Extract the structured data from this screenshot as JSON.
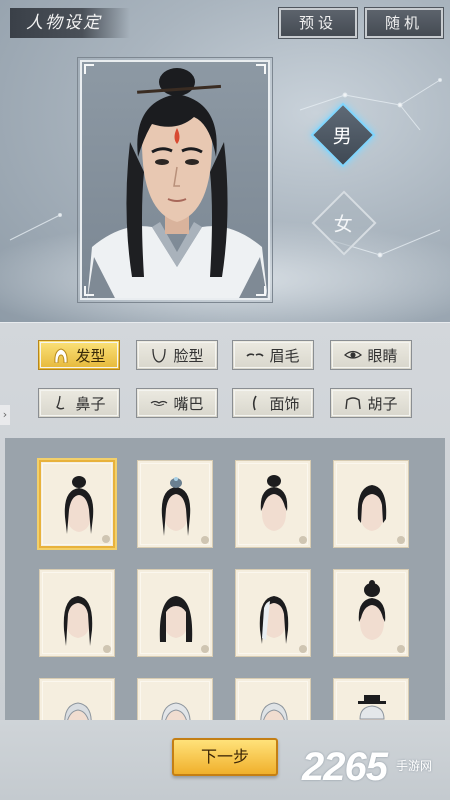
{
  "header": {
    "title": "人物设定",
    "preset_label": "预设",
    "random_label": "随机"
  },
  "gender": {
    "male_label": "男",
    "female_label": "女",
    "selected": "male"
  },
  "tabs": [
    {
      "label": "发型",
      "icon": "hair-icon",
      "active": true
    },
    {
      "label": "脸型",
      "icon": "face-shape-icon",
      "active": false
    },
    {
      "label": "眉毛",
      "icon": "eyebrow-icon",
      "active": false
    },
    {
      "label": "眼睛",
      "icon": "eye-icon",
      "active": false
    },
    {
      "label": "鼻子",
      "icon": "nose-icon",
      "active": false
    },
    {
      "label": "嘴巴",
      "icon": "mouth-icon",
      "active": false
    },
    {
      "label": "面饰",
      "icon": "face-decoration-icon",
      "active": false
    },
    {
      "label": "胡子",
      "icon": "beard-icon",
      "active": false
    }
  ],
  "hairstyles": [
    {
      "style": "topknot-long",
      "selected": true
    },
    {
      "style": "crown-ornament",
      "selected": false
    },
    {
      "style": "topknot-short",
      "selected": false
    },
    {
      "style": "half-tied",
      "selected": false
    },
    {
      "style": "long-straight",
      "selected": false
    },
    {
      "style": "long-bangs",
      "selected": false
    },
    {
      "style": "white-streak",
      "selected": false
    },
    {
      "style": "high-bun",
      "selected": false
    },
    {
      "style": "silver-short",
      "selected": false
    },
    {
      "style": "silver-wavy",
      "selected": false
    },
    {
      "style": "silver-side",
      "selected": false
    },
    {
      "style": "white-hat",
      "selected": false
    }
  ],
  "footer": {
    "next_label": "下一步"
  },
  "watermark": {
    "number": "2265",
    "text": "手游网"
  },
  "colors": {
    "accent_gold": "#f0b02c",
    "male_glow": "#7fd6ff"
  }
}
